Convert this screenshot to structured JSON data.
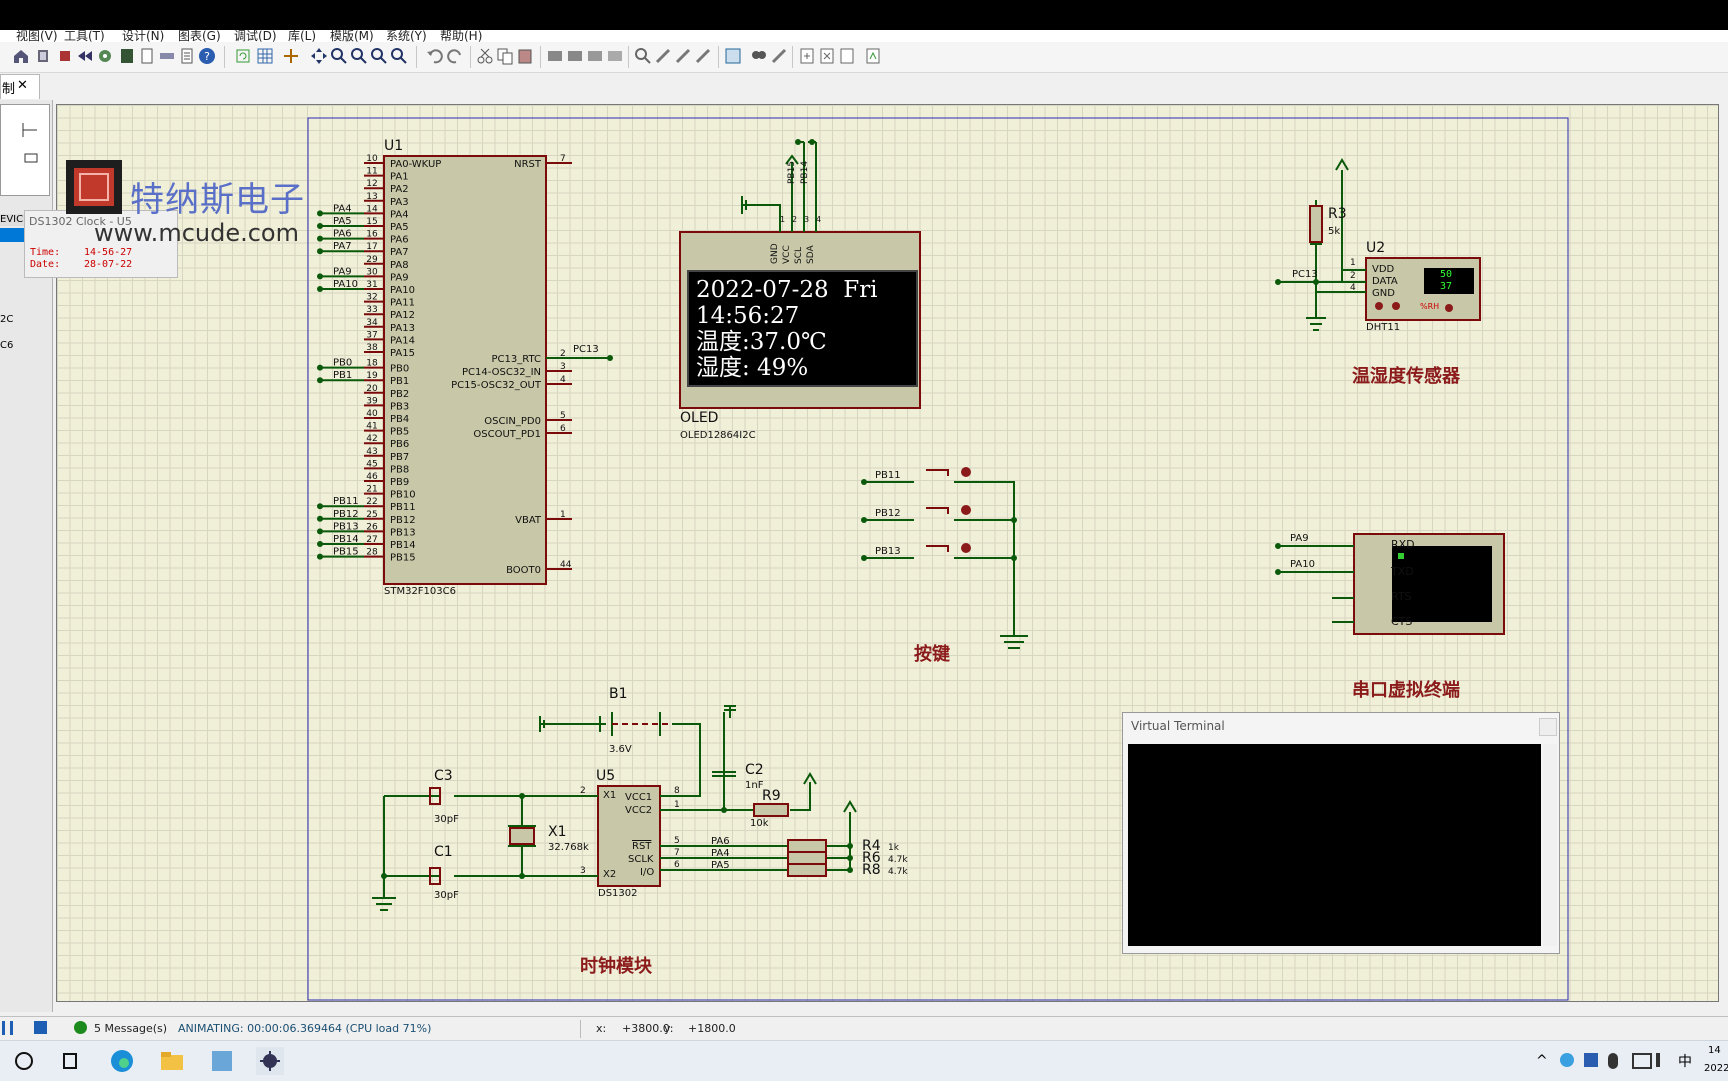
{
  "menu": {
    "items": [
      "视图(V)",
      "工具(T)",
      "设计(N)",
      "图表(G)",
      "调试(D)",
      "库(L)",
      "模版(M)",
      "系统(Y)",
      "帮助(H)"
    ]
  },
  "tab": {
    "label": "制",
    "close": "✕"
  },
  "left_panel": {
    "devices_label": "EVICE",
    "items": [
      "2C",
      "C6"
    ]
  },
  "clock_tooltip": {
    "header": "DS1302 Clock - U5",
    "time_label": "Time:",
    "time": "14-56-27",
    "date_label": "Date:",
    "date": "28-07-22"
  },
  "watermark": {
    "cn": "特纳斯电子",
    "url": "www.mcude.com"
  },
  "oled": {
    "line1": "2022-07-28  Fri",
    "line2": "14:56:27",
    "line3": "温度:37.0℃",
    "line4": "湿度: 49%"
  },
  "schematic": {
    "mcu": {
      "ref": "U1",
      "part": "STM32F103C6",
      "left_pins": [
        [
          "10",
          "PA0-WKUP",
          ""
        ],
        [
          "11",
          "PA1",
          ""
        ],
        [
          "12",
          "PA2",
          ""
        ],
        [
          "13",
          "PA3",
          ""
        ],
        [
          "14",
          "PA4",
          "PA4"
        ],
        [
          "15",
          "PA5",
          "PA5"
        ],
        [
          "16",
          "PA6",
          "PA6"
        ],
        [
          "17",
          "PA7",
          "PA7"
        ],
        [
          "29",
          "PA8",
          ""
        ],
        [
          "30",
          "PA9",
          "PA9"
        ],
        [
          "31",
          "PA10",
          "PA10"
        ],
        [
          "32",
          "PA11",
          ""
        ],
        [
          "33",
          "PA12",
          ""
        ],
        [
          "34",
          "PA13",
          ""
        ],
        [
          "37",
          "PA14",
          ""
        ],
        [
          "38",
          "PA15",
          ""
        ],
        [
          "18",
          "PB0",
          "PB0"
        ],
        [
          "19",
          "PB1",
          "PB1"
        ],
        [
          "20",
          "PB2",
          ""
        ],
        [
          "39",
          "PB3",
          ""
        ],
        [
          "40",
          "PB4",
          ""
        ],
        [
          "41",
          "PB5",
          ""
        ],
        [
          "42",
          "PB6",
          ""
        ],
        [
          "43",
          "PB7",
          ""
        ],
        [
          "45",
          "PB8",
          ""
        ],
        [
          "46",
          "PB9",
          ""
        ],
        [
          "21",
          "PB10",
          ""
        ],
        [
          "22",
          "PB11",
          "PB11"
        ],
        [
          "25",
          "PB12",
          "PB12"
        ],
        [
          "26",
          "PB13",
          "PB13"
        ],
        [
          "27",
          "PB14",
          "PB14"
        ],
        [
          "28",
          "PB15",
          "PB15"
        ]
      ],
      "right_pins": [
        [
          "7",
          "NRST"
        ],
        [
          "2",
          "PC13_RTC"
        ],
        [
          "3",
          "PC14-OSC32_IN"
        ],
        [
          "4",
          "PC15-OSC32_OUT"
        ],
        [
          "5",
          "OSCIN_PD0"
        ],
        [
          "6",
          "OSCOUT_PD1"
        ],
        [
          "1",
          "VBAT"
        ],
        [
          "44",
          "BOOT0"
        ]
      ],
      "pc13_net": "PC13"
    },
    "oled_part": {
      "ref": "OLED",
      "part": "OLED12864I2C",
      "pins": [
        "GND",
        "VCC",
        "SCL",
        "SDA"
      ],
      "pin_nums": [
        "1",
        "2",
        "3",
        "4"
      ],
      "nets": [
        "PB15",
        "PB14"
      ]
    },
    "dht": {
      "ref": "U2",
      "part": "DHT11",
      "pins": [
        "VDD",
        "DATA",
        "GND"
      ],
      "pin_nums": [
        "1",
        "2",
        "4"
      ],
      "readout": [
        "50",
        "37"
      ],
      "unit": "%RH",
      "net": "PC13",
      "r_ref": "R3",
      "r_val": "5k"
    },
    "buttons": {
      "nets": [
        "PB11",
        "PB12",
        "PB13"
      ],
      "label": "按键"
    },
    "rtc": {
      "ref": "U5",
      "part": "DS1302",
      "pins_left": [
        "X1",
        "X2"
      ],
      "pins_right": [
        "VCC1",
        "VCC2",
        "RST",
        "SCLK",
        "I/O"
      ],
      "pin_nums": [
        "2",
        "3",
        "8",
        "1",
        "5",
        "7",
        "6"
      ],
      "nets": [
        "PA6",
        "PA4",
        "PA5"
      ],
      "battery": {
        "ref": "B1",
        "val": "3.6V"
      },
      "caps": [
        {
          "ref": "C3",
          "val": "30pF"
        },
        {
          "ref": "C1",
          "val": "30pF"
        },
        {
          "ref": "C2",
          "val": "1nF"
        }
      ],
      "crystal": {
        "ref": "X1",
        "val": "32.768k"
      },
      "r9": {
        "ref": "R9",
        "val": "10k"
      },
      "resistors": [
        {
          "ref": "R4",
          "val": "1k"
        },
        {
          "ref": "R6",
          "val": "4.7k"
        },
        {
          "ref": "R8",
          "val": "4.7k"
        }
      ],
      "label": "时钟模块"
    },
    "terminal": {
      "pins": [
        "RXD",
        "TXD",
        "RTS",
        "CTS"
      ],
      "nets": [
        "PA9",
        "PA10"
      ],
      "label": "串口虚拟终端"
    },
    "sensor_label": "温湿度传感器"
  },
  "virtual_terminal": {
    "title": "Virtual Terminal"
  },
  "status": {
    "messages": "5 Message(s)",
    "animating": "ANIMATING: 00:00:06.369464 (CPU load 71%)",
    "x_label": "x:",
    "x": "+3800.0",
    "y_label": "y:",
    "y": "+1800.0"
  },
  "taskbar": {
    "ime": "中",
    "clock1": "14",
    "clock2": "2022"
  }
}
